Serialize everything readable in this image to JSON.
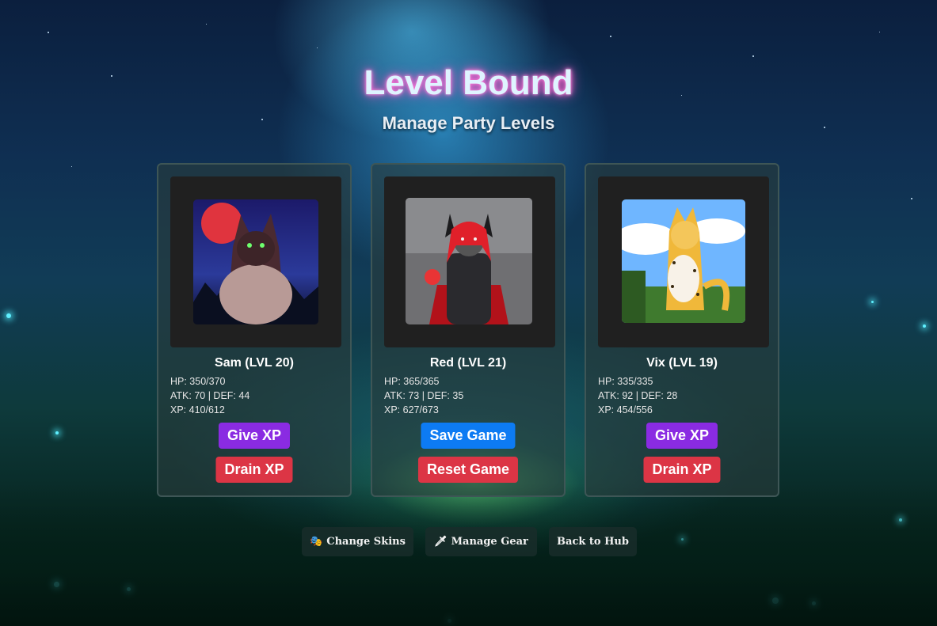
{
  "header": {
    "title": "Level Bound",
    "subtitle": "Manage Party Levels"
  },
  "party": [
    {
      "name": "Sam (LVL 20)",
      "hp": "HP: 350/370",
      "atk_def": "ATK: 70 | DEF: 44",
      "xp": "XP: 410/612",
      "button_primary": "Give XP",
      "button_secondary": "Drain XP"
    },
    {
      "name": "Red (LVL 21)",
      "hp": "HP: 365/365",
      "atk_def": "ATK: 73 | DEF: 35",
      "xp": "XP: 627/673",
      "button_primary": "Save Game",
      "button_secondary": "Reset Game"
    },
    {
      "name": "Vix (LVL 19)",
      "hp": "HP: 335/335",
      "atk_def": "ATK: 92 | DEF: 28",
      "xp": "XP: 454/556",
      "button_primary": "Give XP",
      "button_secondary": "Drain XP"
    }
  ],
  "nav": {
    "change_skins": "Change Skins",
    "manage_gear": "Manage Gear",
    "back_to_hub": "Back to Hub"
  },
  "colors": {
    "give_xp": "#8a2be2",
    "drain_xp": "#dc3545",
    "save_game": "#0d7bf3",
    "title_glow": "#ff4fc4"
  }
}
